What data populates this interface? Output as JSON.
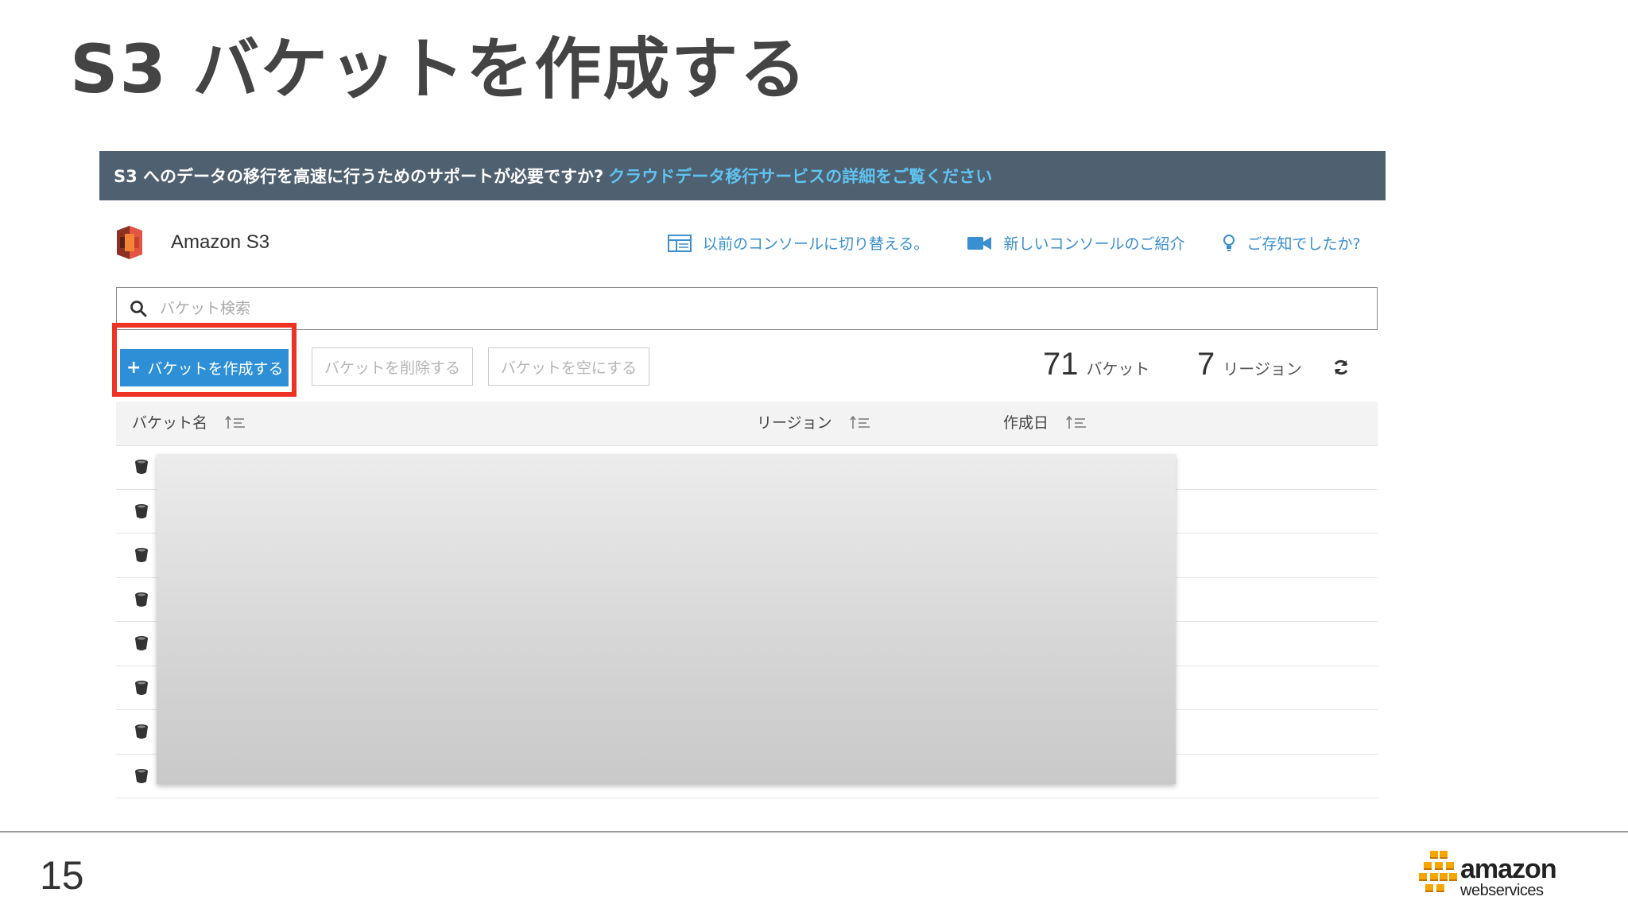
{
  "slide": {
    "title": "S3 バケットを作成する",
    "page_number": "15"
  },
  "banner": {
    "text": "S3 へのデータの移行を高速に行うためのサポートが必要ですか?",
    "link": "クラウドデータ移行サービスの詳細をご覧ください"
  },
  "console": {
    "service_name": "Amazon S3",
    "links": {
      "old_console": "以前のコンソールに切り替える。",
      "new_console_intro": "新しいコンソールのご紹介",
      "did_you_know": "ご存知でしたか?"
    },
    "search": {
      "placeholder": "バケット検索",
      "value": ""
    },
    "buttons": {
      "create": "バケットを作成する",
      "delete": "バケットを削除する",
      "empty": "バケットを空にする"
    },
    "stats": {
      "bucket_count": "71",
      "bucket_unit": "バケット",
      "region_count": "7",
      "region_unit": "リージョン"
    },
    "table": {
      "columns": [
        "バケット名",
        "リージョン",
        "作成日"
      ],
      "row_count": 8
    }
  },
  "brand": {
    "logo_line1": "amazon",
    "logo_line2": "webservices"
  },
  "colors": {
    "highlight": "#ee3322",
    "primary_button": "#2e8fd6",
    "banner_bg": "#4f6070",
    "link": "#3a8fd0"
  }
}
